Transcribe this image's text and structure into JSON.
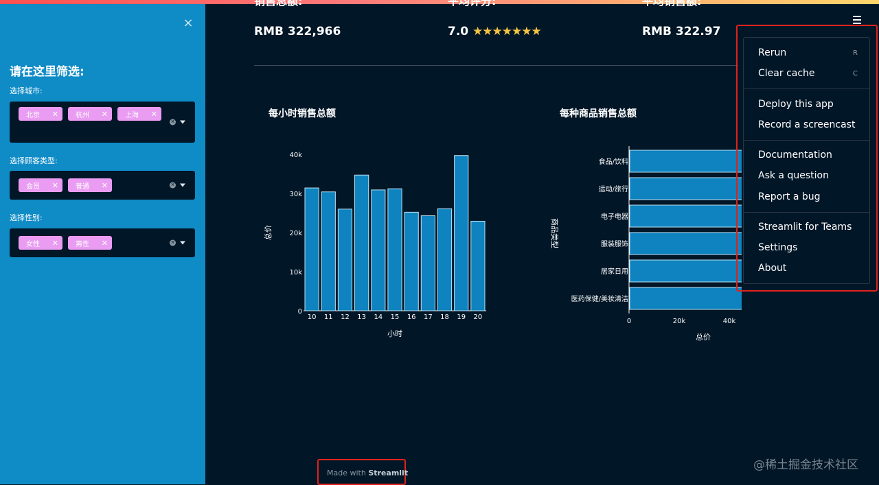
{
  "sidebar": {
    "close_icon": "×",
    "title": "请在这里筛选:",
    "filters": [
      {
        "label": "选择城市:",
        "tags": [
          "北京",
          "杭州",
          "上海"
        ]
      },
      {
        "label": "选择顾客类型:",
        "tags": [
          "会员",
          "普通"
        ]
      },
      {
        "label": "选择性别:",
        "tags": [
          "女性",
          "男性"
        ]
      }
    ]
  },
  "metrics": [
    {
      "label": "销售总额:",
      "value": "RMB 322,966"
    },
    {
      "label": "平均评分:",
      "value": "7.0",
      "stars": "★★★★★★★"
    },
    {
      "label": "平均销售额:",
      "value": "RMB 322.97"
    }
  ],
  "charts": {
    "hourly_title": "每小时销售总额",
    "product_title": "每种商品销售总额"
  },
  "chart_data": [
    {
      "type": "bar",
      "title": "每小时销售总额",
      "xlabel": "小时",
      "ylabel": "总价",
      "categories": [
        "10",
        "11",
        "12",
        "13",
        "14",
        "15",
        "16",
        "17",
        "18",
        "19",
        "20"
      ],
      "values": [
        31400,
        30400,
        26000,
        34700,
        30900,
        31200,
        25200,
        24300,
        26100,
        39700,
        22900
      ],
      "ylim": [
        0,
        40000
      ],
      "yticks": [
        "0",
        "10k",
        "20k",
        "30k",
        "40k"
      ],
      "color": "#0e83c0"
    },
    {
      "type": "bar",
      "orientation": "horizontal",
      "title": "每种商品销售总额",
      "xlabel": "总价",
      "ylabel": "商品类型",
      "categories": [
        "食品/饮料",
        "运动/旅行",
        "电子电器",
        "服装服饰",
        "居家日用",
        "医药保健/美妆清洁"
      ],
      "values": [
        56000,
        55000,
        54000,
        54000,
        53800,
        49200
      ],
      "xticks": [
        "0",
        "20k",
        "40k"
      ],
      "color": "#0e83c0"
    }
  ],
  "menu": {
    "items": [
      {
        "label": "Rerun",
        "key": "R"
      },
      {
        "label": "Clear cache",
        "key": "C"
      },
      {
        "label": "Deploy this app",
        "key": ""
      },
      {
        "label": "Record a screencast",
        "key": ""
      },
      {
        "label": "Documentation",
        "key": ""
      },
      {
        "label": "Ask a question",
        "key": ""
      },
      {
        "label": "Report a bug",
        "key": ""
      },
      {
        "label": "Streamlit for Teams",
        "key": ""
      },
      {
        "label": "Settings",
        "key": ""
      },
      {
        "label": "About",
        "key": ""
      }
    ]
  },
  "footer": {
    "made_with": "Made with",
    "brand": "Streamlit"
  },
  "watermark": "@稀土掘金技术社区",
  "colors": {
    "sidebar": "#0f8bc6",
    "background": "#011627",
    "tag": "#e99cf2",
    "bar": "#0e83c0",
    "highlight": "#e0231b"
  }
}
